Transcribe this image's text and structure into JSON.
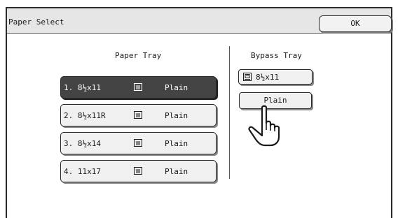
{
  "window": {
    "title": "Paper Select",
    "ok_label": "OK"
  },
  "paper_tray": {
    "label": "Paper Tray",
    "trays": [
      {
        "size": "1. 8½x11",
        "type": "Plain",
        "selected": true
      },
      {
        "size": "2. 8½x11R",
        "type": "Plain",
        "selected": false
      },
      {
        "size": "3. 8½x14",
        "type": "Plain",
        "selected": false
      },
      {
        "size": "4. 11x17",
        "type": "Plain",
        "selected": false
      }
    ]
  },
  "bypass_tray": {
    "label": "Bypass Tray",
    "size": "8½x11",
    "type": "Plain"
  },
  "icons": {
    "tray_icon": "paper-stack-icon",
    "bypass_icon": "bypass-tray-icon",
    "pointer": "pointing-hand-icon"
  },
  "colors": {
    "selected_bg": "#444444",
    "button_bg": "#f0f0f0",
    "header_bg": "#e6e6e6"
  }
}
